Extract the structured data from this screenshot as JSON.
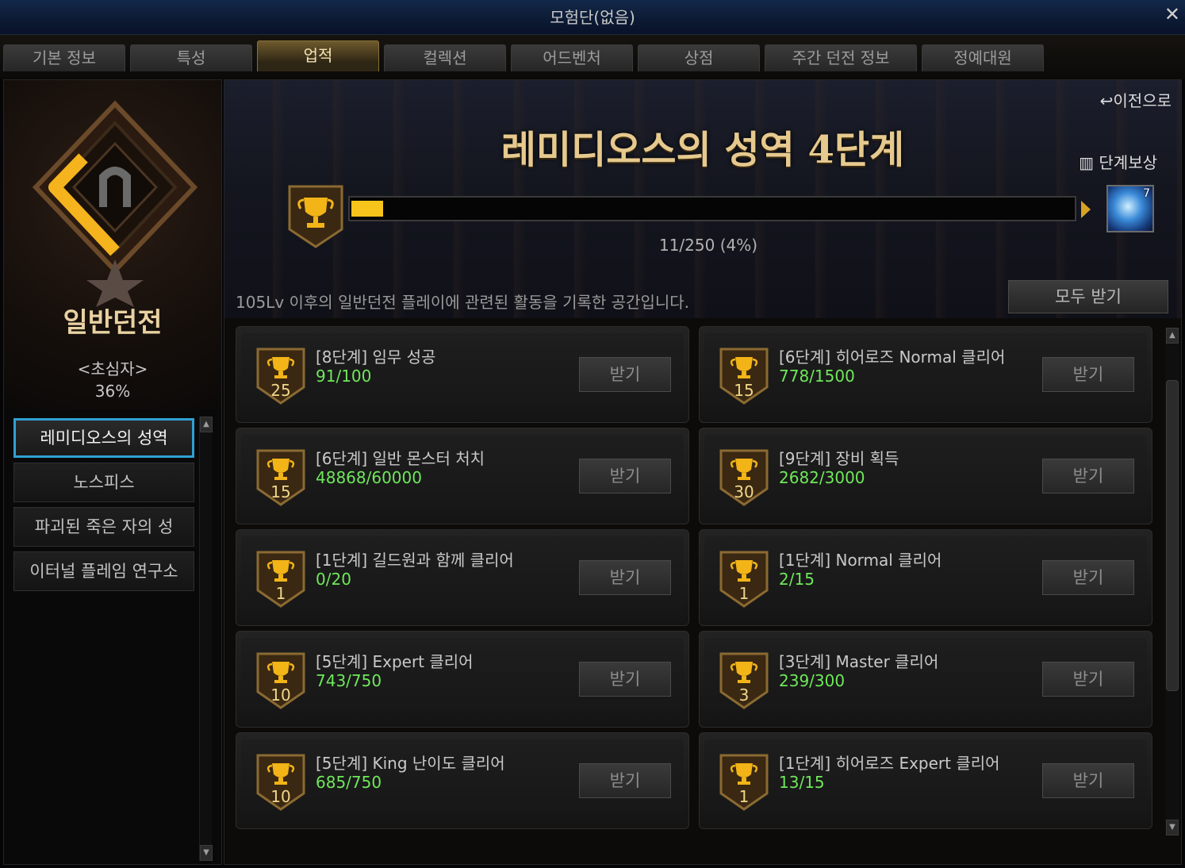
{
  "window": {
    "title": "모험단(없음)",
    "close_label": "✕"
  },
  "tabs": [
    {
      "label": "기본 정보",
      "active": false
    },
    {
      "label": "특성",
      "active": false
    },
    {
      "label": "업적",
      "active": true
    },
    {
      "label": "컬렉션",
      "active": false
    },
    {
      "label": "어드벤처",
      "active": false
    },
    {
      "label": "상점",
      "active": false
    },
    {
      "label": "주간 던전 정보",
      "active": false
    },
    {
      "label": "정예대원",
      "active": false
    }
  ],
  "sidebar": {
    "category": "일반던전",
    "rank": "<초심자>",
    "percent": "36%",
    "items": [
      {
        "label": "레미디오스의 성역",
        "active": true
      },
      {
        "label": "노스피스",
        "active": false
      },
      {
        "label": "파괴된 죽은 자의 성",
        "active": false
      },
      {
        "label": "이터널 플레임 연구소",
        "active": false
      }
    ]
  },
  "banner": {
    "back_label": "이전으로",
    "title": "레미디오스의 성역 4단계",
    "stage_reward_label": "단계보상",
    "reward_count": "7",
    "progress_text": "11/250 (4%)",
    "progress_fraction": 0.044,
    "description": "105Lv 이후의 일반던전 플레이에 관련된 활동을 기록한 공간입니다.",
    "receive_all_label": "모두 받기"
  },
  "accent_colors": {
    "gold": "#f7c41b",
    "progress_green": "#6fe85a",
    "selected_border": "#2fa0d3"
  },
  "achievements": [
    {
      "title": "[8단계] 임무 성공",
      "progress": "91/100",
      "points": "25",
      "button": "받기"
    },
    {
      "title": "[6단계] 히어로즈 Normal 클리어",
      "progress": "778/1500",
      "points": "15",
      "button": "받기"
    },
    {
      "title": "[6단계] 일반 몬스터 처치",
      "progress": "48868/60000",
      "points": "15",
      "button": "받기"
    },
    {
      "title": "[9단계] 장비 획득",
      "progress": "2682/3000",
      "points": "30",
      "button": "받기"
    },
    {
      "title": "[1단계] 길드원과 함께 클리어",
      "progress": "0/20",
      "points": "1",
      "button": "받기"
    },
    {
      "title": "[1단계] Normal 클리어",
      "progress": "2/15",
      "points": "1",
      "button": "받기"
    },
    {
      "title": "[5단계] Expert 클리어",
      "progress": "743/750",
      "points": "10",
      "button": "받기"
    },
    {
      "title": "[3단계] Master 클리어",
      "progress": "239/300",
      "points": "3",
      "button": "받기"
    },
    {
      "title": "[5단계] King 난이도 클리어",
      "progress": "685/750",
      "points": "10",
      "button": "받기"
    },
    {
      "title": "[1단계] 히어로즈 Expert 클리어",
      "progress": "13/15",
      "points": "1",
      "button": "받기"
    }
  ]
}
